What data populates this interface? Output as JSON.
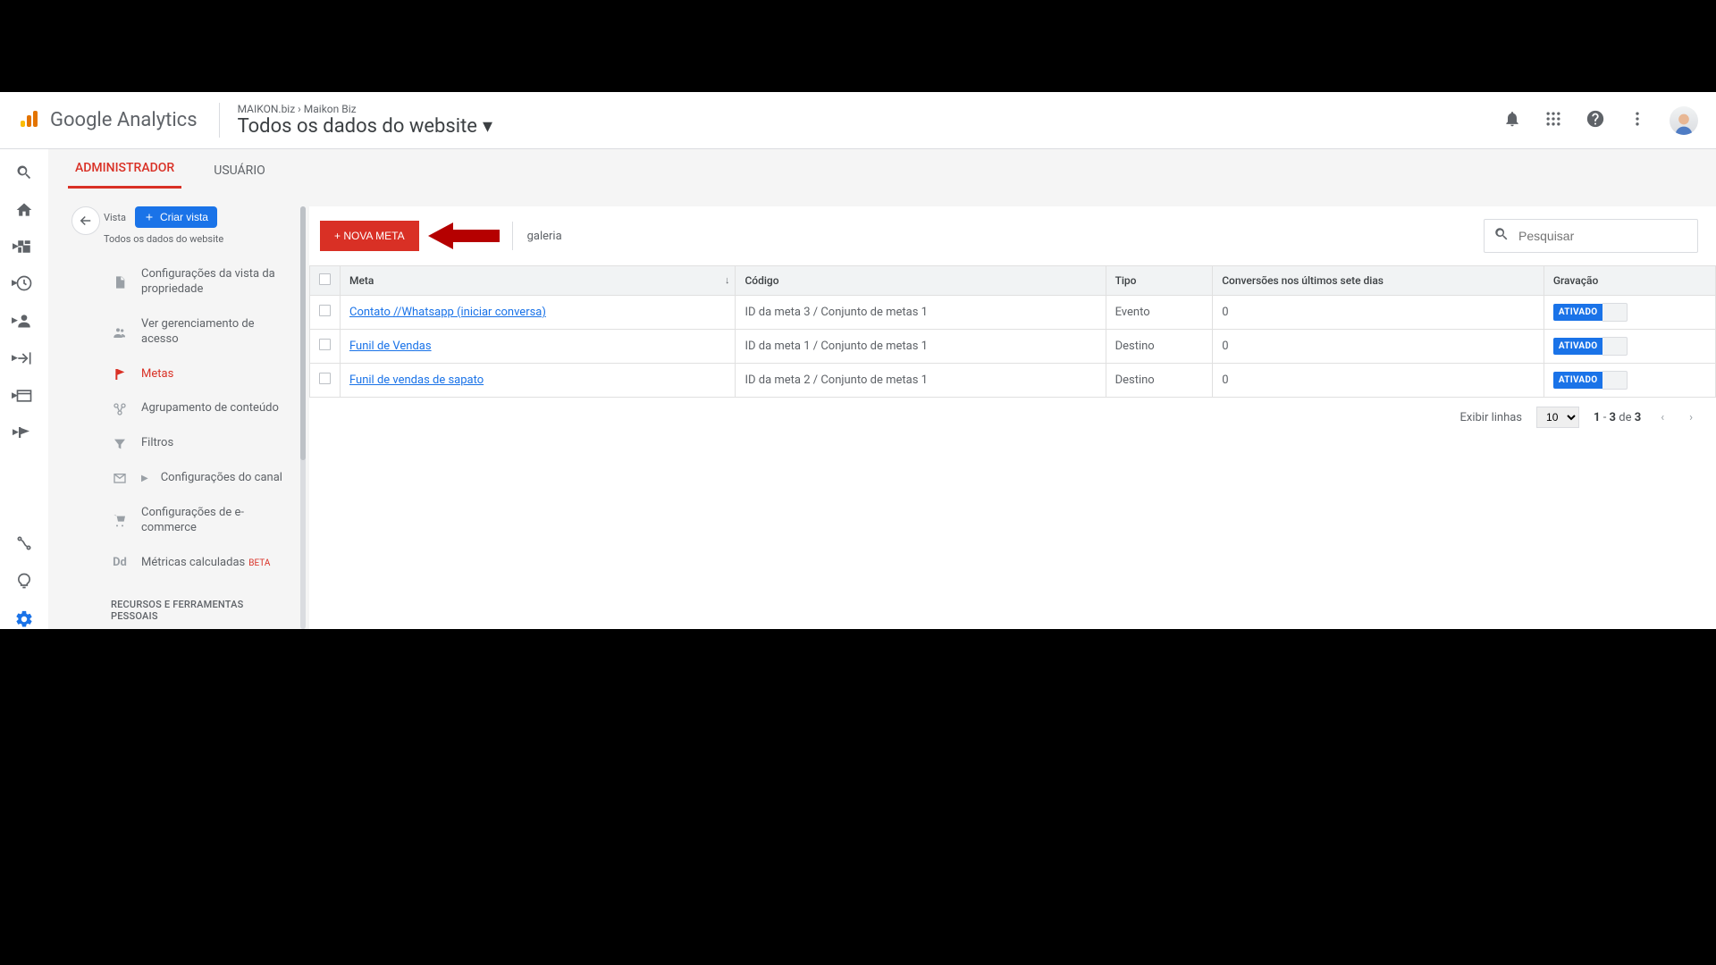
{
  "header": {
    "brand": "Google Analytics",
    "crumb1": "MAIKON.biz",
    "crumb2": "Maikon Biz",
    "title": "Todos os dados do website"
  },
  "tabs": {
    "admin": "ADMINISTRADOR",
    "user": "USUÁRIO"
  },
  "column": {
    "title": "Vista",
    "create": "Criar vista",
    "subtitle": "Todos os dados do website",
    "nav": {
      "view_settings": "Configurações da vista da propriedade",
      "access": "Ver gerenciamento de acesso",
      "goals": "Metas",
      "grouping": "Agrupamento de conteúdo",
      "filters": "Filtros",
      "channel": "Configurações do canal",
      "ecommerce": "Configurações de e-commerce",
      "metrics": "Métricas calculadas",
      "metrics_badge": "BETA"
    },
    "section": "RECURSOS E FERRAMENTAS PESSOAIS"
  },
  "toolbar": {
    "new_goal": "+ NOVA META",
    "gallery": "galeria",
    "search_placeholder": "Pesquisar"
  },
  "table": {
    "headers": {
      "meta": "Meta",
      "codigo": "Código",
      "tipo": "Tipo",
      "conversoes": "Conversões nos últimos sete dias",
      "gravacao": "Gravação"
    },
    "rows": [
      {
        "meta": "Contato //Whatsapp (iniciar conversa)",
        "codigo": "ID da meta 3 / Conjunto de metas 1",
        "tipo": "Evento",
        "conv": "0",
        "toggle": "ATIVADO"
      },
      {
        "meta": "Funil de Vendas",
        "codigo": "ID da meta 1 / Conjunto de metas 1",
        "tipo": "Destino",
        "conv": "0",
        "toggle": "ATIVADO"
      },
      {
        "meta": "Funil de vendas de sapato",
        "codigo": "ID da meta 2 / Conjunto de metas 1",
        "tipo": "Destino",
        "conv": "0",
        "toggle": "ATIVADO"
      }
    ]
  },
  "pager": {
    "show_rows": "Exibir linhas",
    "page_size": "10",
    "range_1": "1",
    "range_2": "3",
    "of": "de",
    "total": "3"
  }
}
